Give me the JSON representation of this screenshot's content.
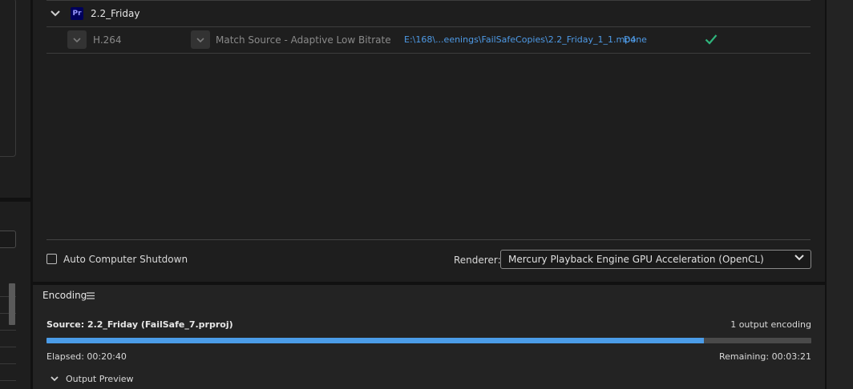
{
  "queue": {
    "group": {
      "name": "2.2_Friday",
      "app_badge": "Pr"
    },
    "item": {
      "format": "H.264",
      "preset": "Match Source - Adaptive Low Bitrate",
      "output": "E:\\168\\...eenings\\FailSafeCopies\\2.2_Friday_1_1.mp4",
      "status": "Done"
    },
    "auto_shutdown_label": "Auto Computer Shutdown",
    "renderer_label": "Renderer:",
    "renderer_value": "Mercury Playback Engine GPU Acceleration (OpenCL)"
  },
  "encoding": {
    "title": "Encoding",
    "source": "Source: 2.2_Friday (FailSafe_7.prproj)",
    "outputs": "1 output encoding",
    "progress": 0.86,
    "elapsed": "Elapsed: 00:20:40",
    "remaining": "Remaining: 00:03:21",
    "preview_label": "Output Preview"
  },
  "colors": {
    "accent": "#4b9ce8",
    "link": "#4e9ae6",
    "success": "#2fb47c"
  }
}
